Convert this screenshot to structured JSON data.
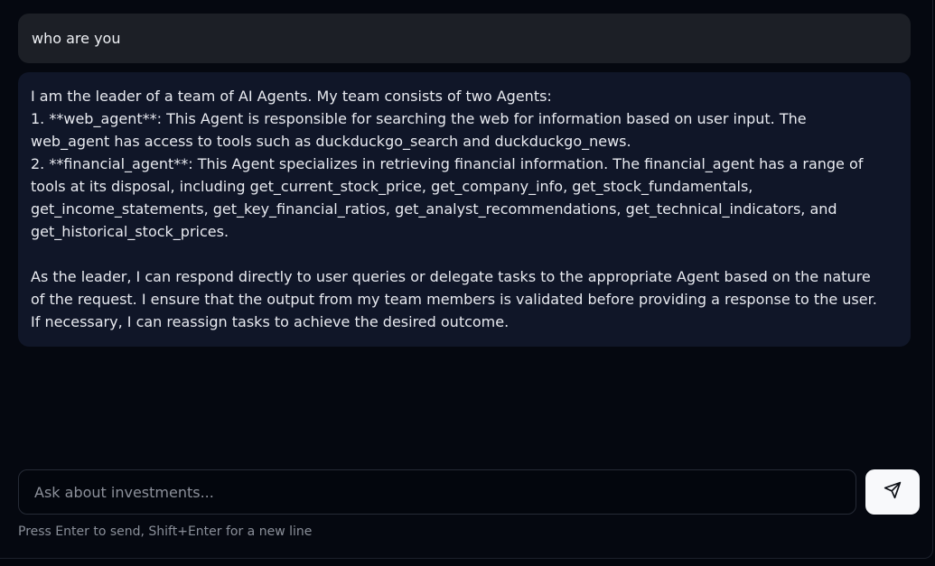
{
  "conversation": {
    "user_message": "who are you",
    "assistant_message": {
      "lines": [
        "I am the leader of a team of AI Agents. My team consists of two Agents:",
        "1. **web_agent**: This Agent is responsible for searching the web for information based on user input. The",
        "web_agent has access to tools such as duckduckgo_search and duckduckgo_news.",
        "2. **financial_agent**: This Agent specializes in retrieving financial information. The financial_agent has a range of",
        "tools at its disposal, including get_current_stock_price, get_company_info, get_stock_fundamentals,",
        "get_income_statements, get_key_financial_ratios, get_analyst_recommendations, get_technical_indicators, and",
        "get_historical_stock_prices.",
        "",
        "As the leader, I can respond directly to user queries or delegate tasks to the appropriate Agent based on the nature",
        "of the request. I ensure that the output from my team members is validated before providing a response to the user.",
        "If necessary, I can reassign tasks to achieve the desired outcome."
      ]
    }
  },
  "composer": {
    "value": "",
    "placeholder": "Ask about investments...",
    "send_icon": "send-icon",
    "hint": "Press Enter to send, Shift+Enter for a new line"
  },
  "colors": {
    "page_background": "#03060d",
    "user_bubble": "#1c1f26",
    "assistant_bubble": "#101628",
    "send_button": "#f8f9fb"
  }
}
